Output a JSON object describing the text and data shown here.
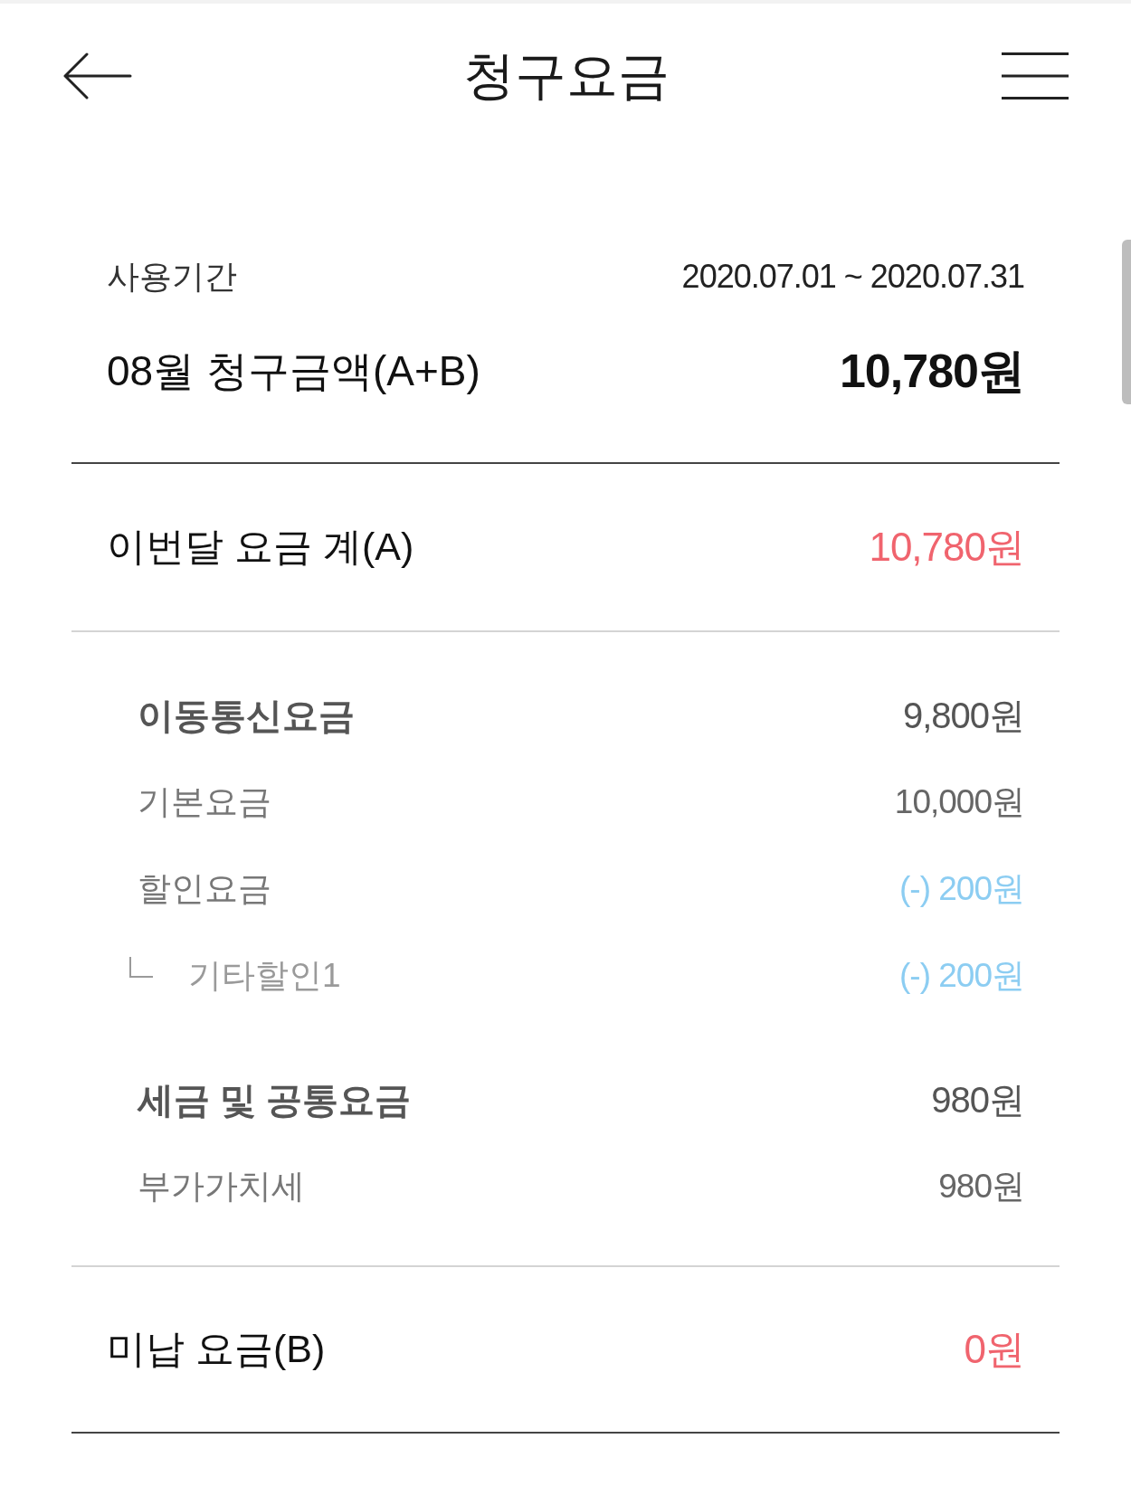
{
  "header": {
    "title": "청구요금"
  },
  "summary": {
    "period_label": "사용기간",
    "period_value": "2020.07.01 ~ 2020.07.31",
    "total_label": "08월 청구금액(A+B)",
    "total_value": "10,780원"
  },
  "this_month": {
    "label": "이번달 요금 계(A)",
    "amount": "10,780원",
    "groups": [
      {
        "label": "이동통신요금",
        "amount": "9,800원",
        "items": [
          {
            "kind": "charge",
            "label": "기본요금",
            "amount": "10,000원"
          },
          {
            "kind": "discount",
            "label": "할인요금",
            "amount": "(-) 200원",
            "children": [
              {
                "kind": "discount",
                "label": "기타할인1",
                "amount": "(-) 200원"
              }
            ]
          }
        ]
      },
      {
        "label": "세금 및 공통요금",
        "amount": "980원",
        "items": [
          {
            "kind": "charge",
            "label": "부가가치세",
            "amount": "980원"
          }
        ]
      }
    ]
  },
  "unpaid": {
    "label": "미납 요금(B)",
    "amount": "0원"
  }
}
